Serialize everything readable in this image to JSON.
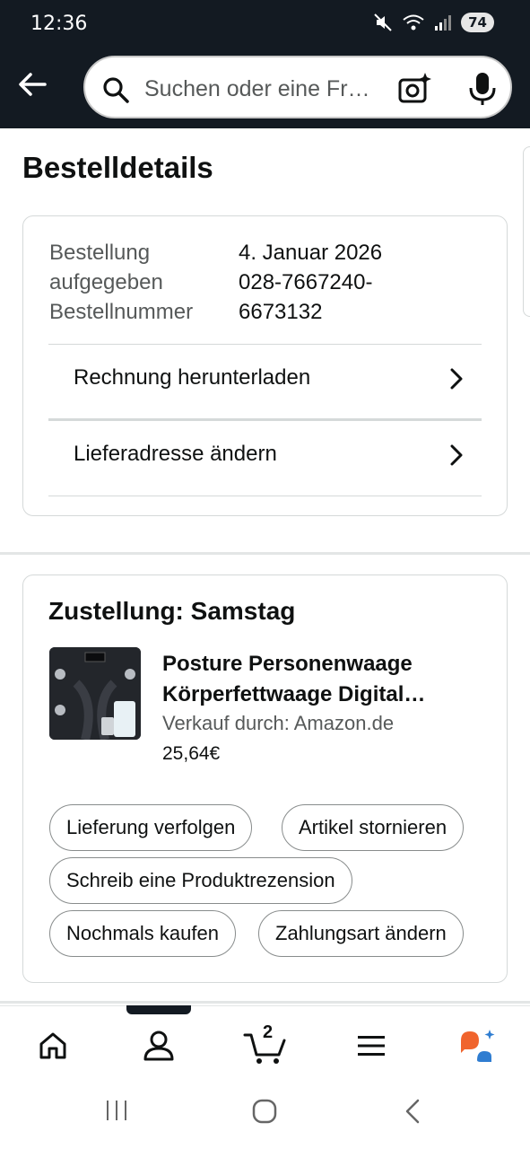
{
  "status_bar": {
    "time": "12:36",
    "battery": "74"
  },
  "search": {
    "placeholder": "Suchen oder eine Fr…"
  },
  "page": {
    "title": "Bestelldetails"
  },
  "order_info": {
    "placed_label_1": "Bestellung",
    "placed_label_2": "aufgegeben",
    "number_label": "Bestellnummer",
    "placed_value": "4. Januar 2026",
    "number_value_1": "028-7667240-",
    "number_value_2": "6673132",
    "links": [
      {
        "label": "Rechnung herunterladen"
      },
      {
        "label": "Lieferadresse ändern"
      }
    ]
  },
  "shipment": {
    "title": "Zustellung: Samstag",
    "product": {
      "title_line_1": "Posture Personenwaage",
      "title_line_2": "Körperfettwaage Digital…",
      "seller": "Verkauf durch: Amazon.de",
      "price": "25,64€"
    },
    "actions": [
      {
        "label": "Lieferung verfolgen"
      },
      {
        "label": "Artikel stornieren"
      },
      {
        "label": "Schreib eine Produktrezension"
      },
      {
        "label": "Nochmals kaufen"
      },
      {
        "label": "Zahlungsart ändern"
      }
    ]
  },
  "bottom_nav": {
    "items": [
      "home-icon",
      "account-icon",
      "cart-icon",
      "menu-icon",
      "assistant-icon"
    ],
    "cart_count": "2",
    "active": "account-icon"
  },
  "colors": {
    "header_bg": "#131a22",
    "text": "#0f1111",
    "muted": "#565959",
    "assistant_orange": "#f0642d",
    "assistant_blue": "#2f7dd1"
  }
}
